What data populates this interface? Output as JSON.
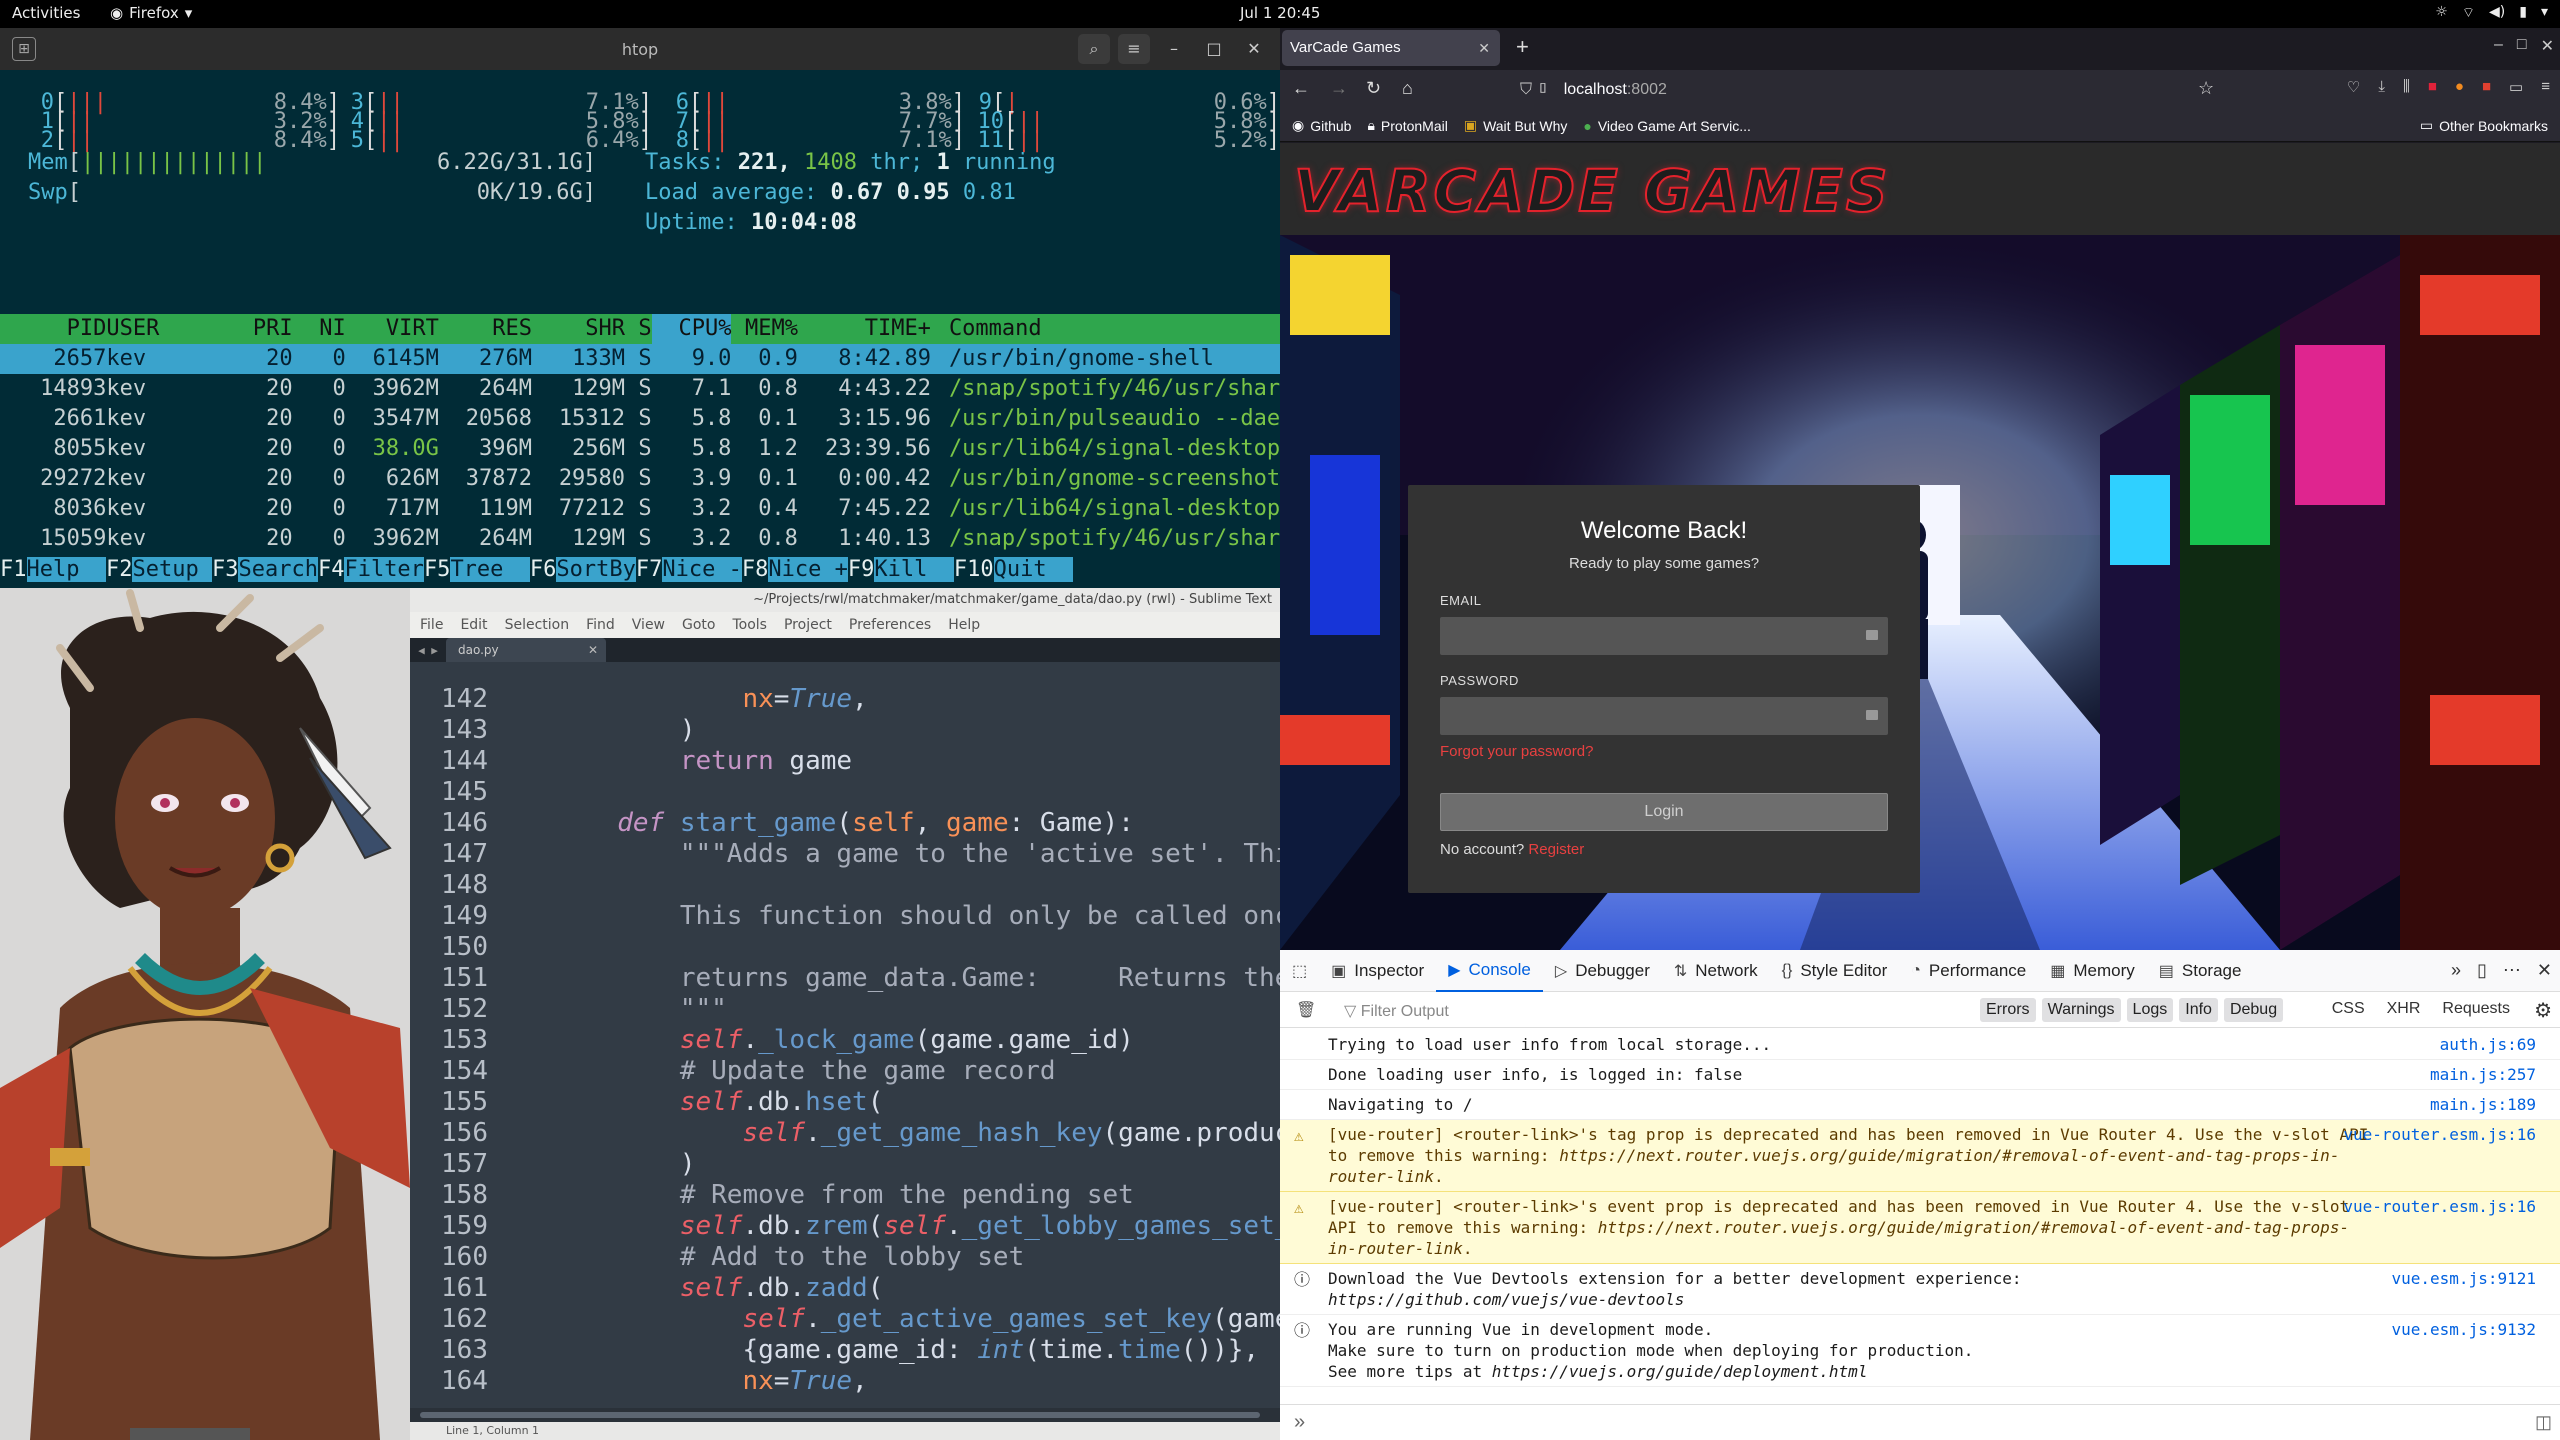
{
  "topbar": {
    "activities": "Activities",
    "app": "Firefox",
    "clock": "Jul 1  20:45"
  },
  "htop": {
    "title": "htop",
    "cpus": [
      {
        "n": "0",
        "bars": "|||",
        "pct": "8.4%"
      },
      {
        "n": "1",
        "bars": "||",
        "pct": "3.2%"
      },
      {
        "n": "2",
        "bars": "||",
        "pct": "8.4%"
      },
      {
        "n": "3",
        "bars": "||",
        "pct": "7.1%"
      },
      {
        "n": "4",
        "bars": "||",
        "pct": "5.8%"
      },
      {
        "n": "5",
        "bars": "||",
        "pct": "6.4%"
      },
      {
        "n": "6",
        "bars": "||",
        "pct": "3.8%"
      },
      {
        "n": "7",
        "bars": "||",
        "pct": "7.7%"
      },
      {
        "n": "8",
        "bars": "||",
        "pct": "7.1%"
      },
      {
        "n": "9",
        "bars": "|",
        "pct": "0.6%"
      },
      {
        "n": "10",
        "bars": "||",
        "pct": "5.8%"
      },
      {
        "n": "11",
        "bars": "||",
        "pct": "5.2%"
      }
    ],
    "mem_label": "Mem",
    "mem_bars": "||||||||||||||",
    "mem_value": "6.22G/31.1G",
    "swp_label": "Swp",
    "swp_value": "0K/19.6G",
    "tasks_label": "Tasks:",
    "tasks_value": "221,",
    "thr_value": "1408",
    "thr_label": "thr;",
    "running_value": "1",
    "running_label": "running",
    "load_label": "Load average:",
    "load1": "0.67",
    "load5": "0.95",
    "load15": "0.81",
    "uptime_label": "Uptime:",
    "uptime_value": "10:04:08",
    "header": {
      "pid": "PID",
      "user": "USER",
      "pri": "PRI",
      "ni": "NI",
      "virt": "VIRT",
      "res": "RES",
      "shr": "SHR",
      "s": "S",
      "cpu": "CPU%",
      "mem": "MEM%",
      "time": "TIME+",
      "command": "Command"
    },
    "processes": [
      {
        "pid": "2657",
        "user": "kev",
        "pri": "20",
        "ni": "0",
        "virt": "6145M",
        "res": "276M",
        "shr": "133M",
        "s": "S",
        "cpu": "9.0",
        "mem": "0.9",
        "time": "8:42.89",
        "cmd": "/usr/bin/gnome-shell"
      },
      {
        "pid": "14893",
        "user": "kev",
        "pri": "20",
        "ni": "0",
        "virt": "3962M",
        "res": "264M",
        "shr": "129M",
        "s": "S",
        "cpu": "7.1",
        "mem": "0.8",
        "time": "4:43.22",
        "cmd": "/snap/spotify/46/usr/share/"
      },
      {
        "pid": "2661",
        "user": "kev",
        "pri": "20",
        "ni": "0",
        "virt": "3547M",
        "res": "20568",
        "shr": "15312",
        "s": "S",
        "cpu": "5.8",
        "mem": "0.1",
        "time": "3:15.96",
        "cmd": "/usr/bin/pulseaudio --daemo"
      },
      {
        "pid": "8055",
        "user": "kev",
        "pri": "20",
        "ni": "0",
        "virt": "38.0G",
        "res": "396M",
        "shr": "256M",
        "s": "S",
        "cpu": "5.8",
        "mem": "1.2",
        "time": "23:39.56",
        "cmd": "/usr/lib64/signal-desktop/s"
      },
      {
        "pid": "29272",
        "user": "kev",
        "pri": "20",
        "ni": "0",
        "virt": "626M",
        "res": "37872",
        "shr": "29580",
        "s": "S",
        "cpu": "3.9",
        "mem": "0.1",
        "time": "0:00.42",
        "cmd": "/usr/bin/gnome-screenshot -"
      },
      {
        "pid": "8036",
        "user": "kev",
        "pri": "20",
        "ni": "0",
        "virt": "717M",
        "res": "119M",
        "shr": "77212",
        "s": "S",
        "cpu": "3.2",
        "mem": "0.4",
        "time": "7:45.22",
        "cmd": "/usr/lib64/signal-desktop/s"
      },
      {
        "pid": "15059",
        "user": "kev",
        "pri": "20",
        "ni": "0",
        "virt": "3962M",
        "res": "264M",
        "shr": "129M",
        "s": "S",
        "cpu": "3.2",
        "mem": "0.8",
        "time": "1:40.13",
        "cmd": "/snap/spotify/46/usr/share/"
      }
    ],
    "fkeys": [
      {
        "k": "F1",
        "l": "Help  "
      },
      {
        "k": "F2",
        "l": "Setup "
      },
      {
        "k": "F3",
        "l": "Search"
      },
      {
        "k": "F4",
        "l": "Filter"
      },
      {
        "k": "F5",
        "l": "Tree  "
      },
      {
        "k": "F6",
        "l": "SortBy"
      },
      {
        "k": "F7",
        "l": "Nice -"
      },
      {
        "k": "F8",
        "l": "Nice +"
      },
      {
        "k": "F9",
        "l": "Kill  "
      },
      {
        "k": "F10",
        "l": "Quit  "
      }
    ]
  },
  "editor": {
    "title": "~/Projects/rwl/matchmaker/matchmaker/game_data/dao.py (rwl) - Sublime Text",
    "menu": [
      "File",
      "Edit",
      "Selection",
      "Find",
      "View",
      "Goto",
      "Tools",
      "Project",
      "Preferences",
      "Help"
    ],
    "tab": "dao.py",
    "status": "Line 1, Column 1",
    "lines": [
      "142",
      "143",
      "144",
      "145",
      "146",
      "147",
      "148",
      "149",
      "150",
      "151",
      "152",
      "153",
      "154",
      "155",
      "156",
      "157",
      "158",
      "159",
      "160",
      "161",
      "162",
      "163",
      "164"
    ]
  },
  "firefox": {
    "tab_title": "VarCade Games",
    "url_host": "localhost",
    "url_port": ":8002",
    "bookmarks": [
      "Github",
      "ProtonMail",
      "Wait But Why",
      "Video Game Art Servic..."
    ],
    "other_bookmarks": "Other Bookmarks"
  },
  "site": {
    "logo": "VarCade Games",
    "login": {
      "title": "Welcome Back!",
      "subtitle": "Ready to play some games?",
      "email_label": "EMAIL",
      "password_label": "PASSWORD",
      "forgot": "Forgot your password?",
      "login_button": "Login",
      "no_account": "No account?",
      "register": "Register"
    }
  },
  "devtools": {
    "tabs": [
      "Inspector",
      "Console",
      "Debugger",
      "Network",
      "Style Editor",
      "Performance",
      "Memory",
      "Storage"
    ],
    "filter_placeholder": "Filter Output",
    "levels": [
      "Errors",
      "Warnings",
      "Logs",
      "Info",
      "Debug"
    ],
    "extra": [
      "CSS",
      "XHR",
      "Requests"
    ],
    "messages": [
      {
        "type": "log",
        "text": "Trying to load user info from local storage...",
        "src": "auth.js:69"
      },
      {
        "type": "log",
        "text": "Done loading user info, is logged in: false",
        "src": "main.js:257"
      },
      {
        "type": "log",
        "text": "Navigating to /",
        "src": "main.js:189"
      },
      {
        "type": "warn",
        "text": "[vue-router] <router-link>'s tag prop is deprecated and has been removed in Vue Router 4. Use the v-slot API to remove this warning: ",
        "link": "https://next.router.vuejs.org/guide/migration/#removal-of-event-and-tag-props-in-router-link",
        "tail": ".",
        "src": "vue-router.esm.js:16"
      },
      {
        "type": "warn",
        "text": "[vue-router] <router-link>'s event prop is deprecated and has been removed in Vue Router 4. Use the v-slot API to remove this warning: ",
        "link": "https://next.router.vuejs.org/guide/migration/#removal-of-event-and-tag-props-in-router-link",
        "tail": ".",
        "src": "vue-router.esm.js:16"
      },
      {
        "type": "info",
        "text": "Download the Vue Devtools extension for a better development experience:\n",
        "link": "https://github.com/vuejs/vue-devtools",
        "tail": "",
        "src": "vue.esm.js:9121"
      },
      {
        "type": "info",
        "text": "You are running Vue in development mode.\nMake sure to turn on production mode when deploying for production.\nSee more tips at ",
        "link": "https://vuejs.org/guide/deployment.html",
        "tail": "",
        "src": "vue.esm.js:9132"
      }
    ],
    "prompt": "»"
  },
  "colors": {
    "htop_bg": "#012b36",
    "htop_header": "#2fa64d",
    "htop_selected": "#3aa3cc",
    "brand_red": "#e4222c",
    "devtools_accent": "#0060df"
  }
}
